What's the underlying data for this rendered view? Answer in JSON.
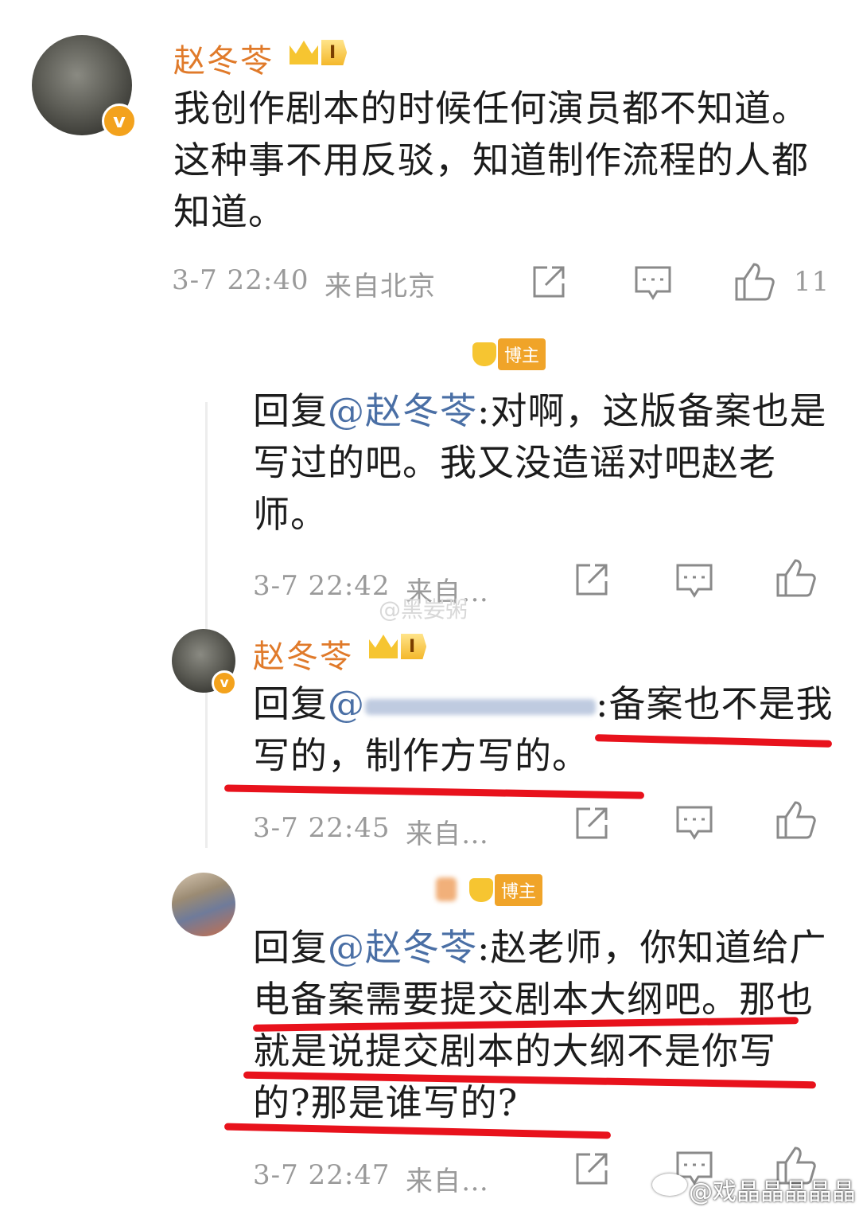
{
  "post": {
    "author": "赵冬苓",
    "level": "I",
    "verified_mark": "v",
    "text": "我创作剧本的时候任何演员都不知道。这种事不用反驳，知道制作流程的人都知道。",
    "time": "3-7 22:40",
    "source": "来自北京",
    "like_count": "11"
  },
  "comments": [
    {
      "badge": "博主",
      "reply_prefix": "回复",
      "mention": "@赵冬苓",
      "text": ":对啊，这版备案也是写过的吧。我又没造谣对吧赵老师。",
      "time": "3-7 22:42",
      "source": "来自…"
    },
    {
      "author": "赵冬苓",
      "level": "I",
      "verified_mark": "v",
      "reply_prefix": "回复",
      "mention": "@",
      "text": ":备案也不是我写的，制作方写的。",
      "time": "3-7 22:45",
      "source": "来自…"
    },
    {
      "badge": "博主",
      "reply_prefix": "回复",
      "mention": "@赵冬苓",
      "text": ":赵老师，你知道给广电备案需要提交剧本大纲吧。那也就是说提交剧本的大纲不是你写的?那是谁写的?",
      "time": "3-7 22:47",
      "source": "来自…"
    }
  ],
  "watermarks": {
    "middle": "@黑妛粥",
    "bottom": "@戏晶晶晶晶晶"
  },
  "icons": [
    "share-icon",
    "comment-icon",
    "like-icon"
  ],
  "colors": {
    "name": "#e07a2a",
    "mention": "#4a6fa5",
    "underline": "#e8121c",
    "meta": "#9a9a9a"
  }
}
